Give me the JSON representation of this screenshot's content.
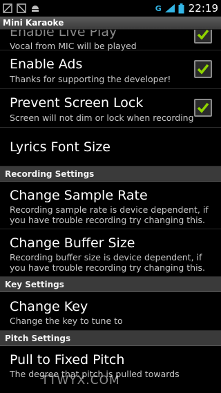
{
  "status_bar": {
    "network": "G",
    "time": "22:19",
    "icons": [
      "image-icon",
      "image-icon",
      "android-icon"
    ]
  },
  "app": {
    "title": "Mini Karaoke"
  },
  "prefs_top": [
    {
      "title": "Enable Live Play",
      "summary": "Vocal from MIC will be played",
      "checked": true
    },
    {
      "title": "Enable Ads",
      "summary": "Thanks for supporting the developer!",
      "checked": true
    },
    {
      "title": "Prevent Screen Lock",
      "summary": "Screen will not dim or lock when recording",
      "checked": true
    },
    {
      "title": "Lyrics Font Size"
    }
  ],
  "sections": {
    "recording": "Recording Settings",
    "key": "Key Settings",
    "pitch": "Pitch Settings"
  },
  "recording_items": [
    {
      "title": "Change Sample Rate",
      "summary": "Recording sample rate is device dependent, if you have trouble recording try changing this."
    },
    {
      "title": "Change Buffer Size",
      "summary": "Recording buffer size is device dependent, if you have trouble recording try changing this."
    }
  ],
  "key_items": [
    {
      "title": "Change Key",
      "summary": "Change the key to tune to"
    }
  ],
  "pitch_items": [
    {
      "title": "Pull to Fixed Pitch",
      "summary": "The degree that pitch is pulled towards"
    }
  ],
  "watermark": "TTWYX.COM",
  "colors": {
    "accent": "#33b5e5",
    "check": "#8fd400"
  }
}
